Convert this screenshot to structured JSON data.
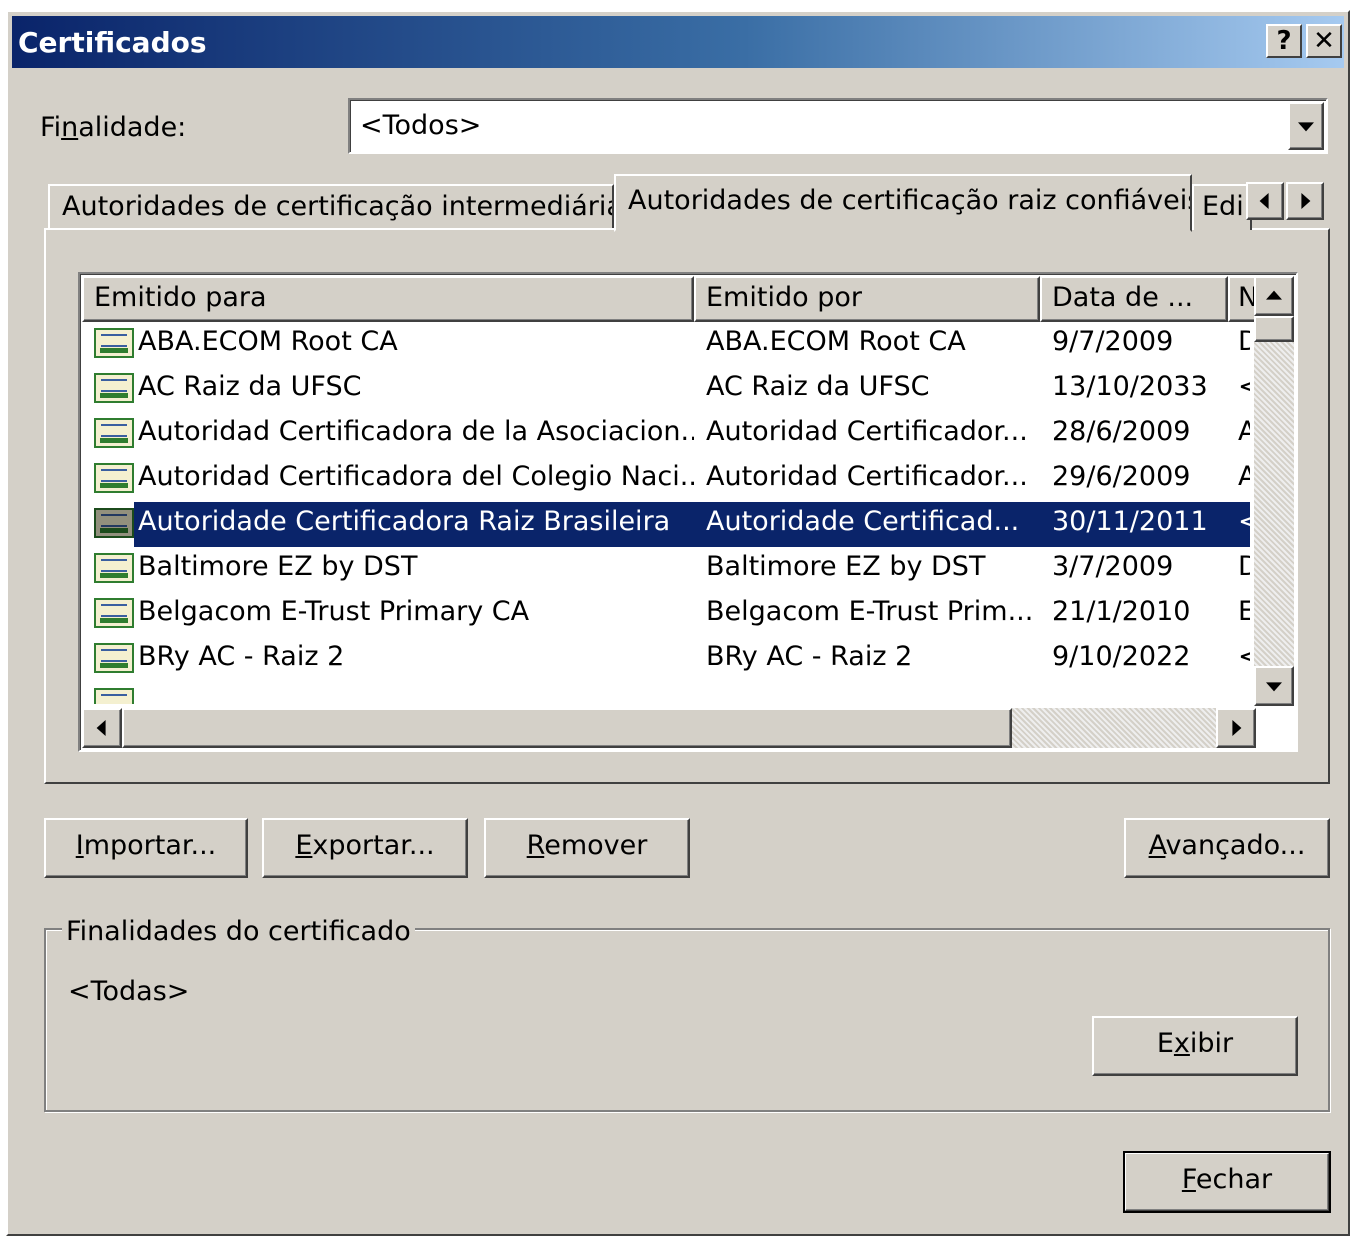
{
  "window": {
    "title": "Certificados",
    "help_button": "?",
    "close_button": "✕"
  },
  "purpose": {
    "label": "Finalidade:",
    "value": "<Todos>"
  },
  "tabs": [
    {
      "label": "Autoridades de certificação intermediárias",
      "active": false
    },
    {
      "label": "Autoridades de certificação raiz confiáveis",
      "active": true
    },
    {
      "label": "Edi",
      "active": false
    }
  ],
  "table": {
    "columns": [
      "Emitido para",
      "Emitido por",
      "Data de ...",
      "N"
    ],
    "rows": [
      {
        "issued_to": "ABA.ECOM Root CA",
        "issued_by": "ABA.ECOM Root CA",
        "date": "9/7/2009",
        "name": "D",
        "selected": false
      },
      {
        "issued_to": "AC Raiz da UFSC",
        "issued_by": "AC Raiz da UFSC",
        "date": "13/10/2033",
        "name": "<",
        "selected": false
      },
      {
        "issued_to": "Autoridad Certificadora de la Asociacion...",
        "issued_by": "Autoridad Certificador...",
        "date": "28/6/2009",
        "name": "A",
        "selected": false
      },
      {
        "issued_to": "Autoridad Certificadora del Colegio Naci...",
        "issued_by": "Autoridad Certificador...",
        "date": "29/6/2009",
        "name": "A",
        "selected": false
      },
      {
        "issued_to": "Autoridade Certificadora Raiz Brasileira",
        "issued_by": "Autoridade Certificad...",
        "date": "30/11/2011",
        "name": "<",
        "selected": true
      },
      {
        "issued_to": "Baltimore EZ by DST",
        "issued_by": "Baltimore EZ by DST",
        "date": "3/7/2009",
        "name": "D",
        "selected": false
      },
      {
        "issued_to": "Belgacom E-Trust Primary CA",
        "issued_by": "Belgacom E-Trust Prim...",
        "date": "21/1/2010",
        "name": "E",
        "selected": false
      },
      {
        "issued_to": "BRy AC - Raiz 2",
        "issued_by": "BRy AC - Raiz 2",
        "date": "9/10/2022",
        "name": "<",
        "selected": false
      }
    ]
  },
  "buttons": {
    "import": {
      "pre": "",
      "key": "I",
      "post": "mportar..."
    },
    "export": {
      "pre": "",
      "key": "E",
      "post": "xportar..."
    },
    "remove": {
      "pre": "",
      "key": "R",
      "post": "emover"
    },
    "advanced": {
      "pre": "",
      "key": "A",
      "post": "vançado..."
    },
    "view": {
      "pre": "E",
      "key": "x",
      "post": "ibir"
    },
    "close": {
      "pre": "",
      "key": "F",
      "post": "echar"
    }
  },
  "purposes_group": {
    "title": "Finalidades do certificado",
    "value": "<Todas>"
  },
  "purpose_label_parts": {
    "pre": "Fi",
    "key": "n",
    "post": "alidade:"
  }
}
